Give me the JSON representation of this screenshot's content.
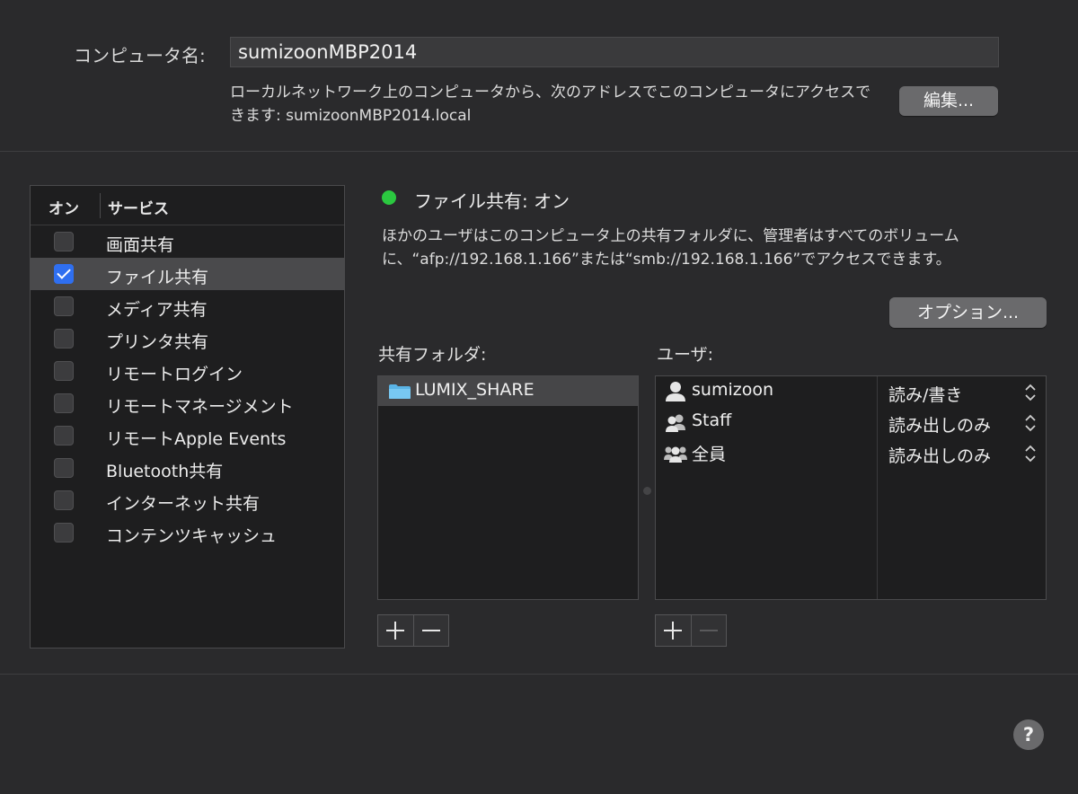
{
  "computer_name": {
    "label": "コンピュータ名:",
    "value": "sumizoonMBP2014",
    "description": "ローカルネットワーク上のコンピュータから、次のアドレスでこのコンピュータにアクセスできます: sumizoonMBP2014.local",
    "edit_button": "編集..."
  },
  "services": {
    "header_on": "オン",
    "header_service": "サービス",
    "items": [
      {
        "label": "画面共有",
        "checked": false,
        "selected": false
      },
      {
        "label": "ファイル共有",
        "checked": true,
        "selected": true
      },
      {
        "label": "メディア共有",
        "checked": false,
        "selected": false
      },
      {
        "label": "プリンタ共有",
        "checked": false,
        "selected": false
      },
      {
        "label": "リモートログイン",
        "checked": false,
        "selected": false
      },
      {
        "label": "リモートマネージメント",
        "checked": false,
        "selected": false
      },
      {
        "label": "リモートApple Events",
        "checked": false,
        "selected": false
      },
      {
        "label": "Bluetooth共有",
        "checked": false,
        "selected": false
      },
      {
        "label": "インターネット共有",
        "checked": false,
        "selected": false
      },
      {
        "label": "コンテンツキャッシュ",
        "checked": false,
        "selected": false
      }
    ]
  },
  "status": {
    "color": "#2bc840",
    "title": "ファイル共有: オン",
    "description": "ほかのユーザはこのコンピュータ上の共有フォルダに、管理者はすべてのボリュームに、“afp://192.168.1.166”または“smb://192.168.1.166”でアクセスできます。",
    "options_button": "オプション..."
  },
  "shared_folders": {
    "label": "共有フォルダ:",
    "items": [
      {
        "name": "LUMIX_SHARE",
        "icon": "folder-icon",
        "selected": true
      }
    ]
  },
  "users": {
    "label": "ユーザ:",
    "items": [
      {
        "name": "sumizoon",
        "icon": "user-icon",
        "permission": "読み/書き"
      },
      {
        "name": "Staff",
        "icon": "group-icon",
        "permission": "読み出しのみ"
      },
      {
        "name": "全員",
        "icon": "everyone-icon",
        "permission": "読み出しのみ"
      }
    ]
  },
  "help": "?"
}
